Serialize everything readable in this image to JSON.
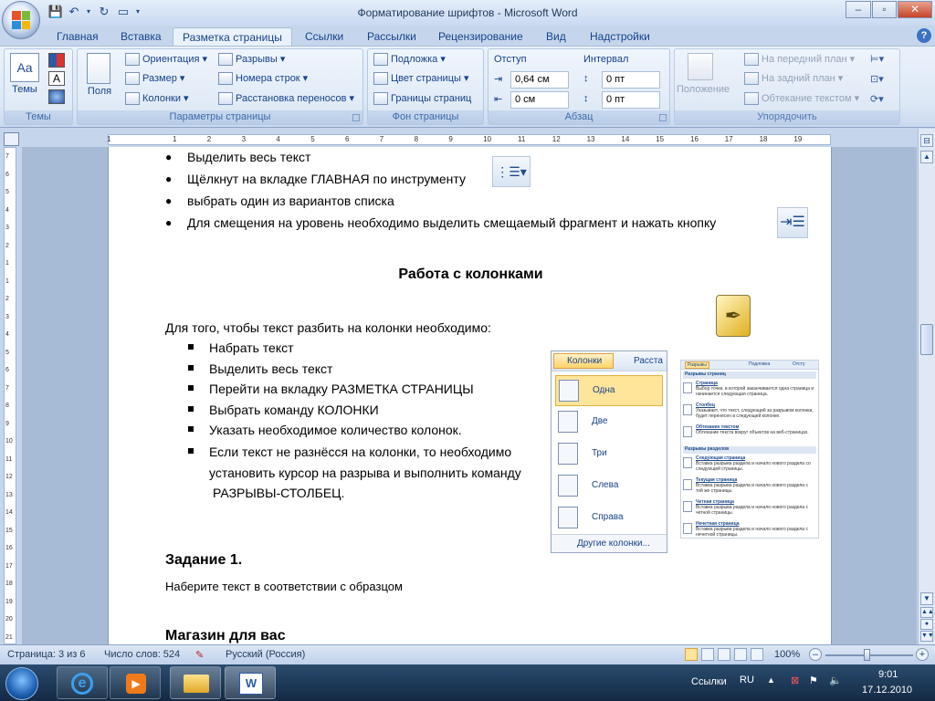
{
  "window": {
    "title": "Форматирование шрифтов - Microsoft Word"
  },
  "tabs": [
    "Главная",
    "Вставка",
    "Разметка страницы",
    "Ссылки",
    "Рассылки",
    "Рецензирование",
    "Вид",
    "Надстройки"
  ],
  "active_tab": "Разметка страницы",
  "ribbon": {
    "themes": {
      "label": "Темы",
      "group": "Темы"
    },
    "page_setup": {
      "fields": "Поля",
      "orientation": "Ориентация",
      "size": "Размер",
      "columns": "Колонки",
      "breaks": "Разрывы",
      "line_numbers": "Номера строк",
      "hyphenation": "Расстановка переносов",
      "group": "Параметры страницы"
    },
    "page_background": {
      "watermark": "Подложка",
      "page_color": "Цвет страницы",
      "page_borders": "Границы страниц",
      "group": "Фон страницы"
    },
    "paragraph": {
      "indent_header": "Отступ",
      "spacing_header": "Интервал",
      "indent_left": "0,64 см",
      "indent_right": "0 см",
      "spacing_before": "0 пт",
      "spacing_after": "0 пт",
      "group": "Абзац"
    },
    "arrange": {
      "position": "Положение",
      "bring_front": "На передний план",
      "send_back": "На задний план",
      "text_wrap": "Обтекание текстом",
      "group": "Упорядочить"
    }
  },
  "document": {
    "bullets_top": [
      "Выделить весь текст",
      "Щёлкнут на вкладке ГЛАВНАЯ по инструменту",
      "выбрать один из вариантов списка",
      "Для смещения на уровень необходимо выделить смещаемый фрагмент и нажать кнопку"
    ],
    "heading": "Работа с колонками",
    "intro": "Для того, чтобы текст разбить на колонки необходимо:",
    "steps": [
      "Набрать текст",
      "Выделить весь текст",
      "Перейти на вкладку РАЗМЕТКА СТРАНИЦЫ",
      "Выбрать команду КОЛОНКИ",
      "Указать необходимое количество колонок."
    ],
    "last_step_lines": [
      "Если текст не разнёсся на колонки, то необходимо",
      "установить курсор на разрыва и выполнить команду",
      "РАЗРЫВЫ-СТОЛБЕЦ."
    ],
    "task_heading": "Задание 1.",
    "task_text": "Наберите текст в соответствии с образцом",
    "bottom_heading": "Магазин для вас"
  },
  "columns_menu": {
    "button": "Колонки",
    "next_tab": "Расста",
    "items": [
      "Одна",
      "Две",
      "Три",
      "Слева",
      "Справа"
    ],
    "more": "Другие колонки..."
  },
  "breaks_picture": {
    "tabs": [
      "Разрывы",
      "Подложка",
      "Отсту"
    ],
    "section1": "Разрывы страниц",
    "section2": "Разрывы разделов",
    "entries": [
      {
        "title": "Страница",
        "desc": "Выбор точки, в которой заканчивается одна страница и начинается следующая страница."
      },
      {
        "title": "Столбец",
        "desc": "Указывает, что текст, следующий за разрывом колонки, будет перенесен в следующей колонке."
      },
      {
        "title": "Обтекание текстом",
        "desc": "Обтекание текста вокруг объектов на веб-страницах."
      },
      {
        "title": "Следующая страница",
        "desc": "Вставка разрыва раздела и начало нового раздела со следующей страницы."
      },
      {
        "title": "Текущая страница",
        "desc": "Вставка разрыва раздела и начало нового раздела с той же страницы."
      },
      {
        "title": "Четная страница",
        "desc": "Вставка разрыва раздела и начало нового раздела с четной страницы."
      },
      {
        "title": "Нечетная страница",
        "desc": "Вставка разрыва раздела и начало нового раздела с нечетной страницы."
      }
    ]
  },
  "status": {
    "page": "Страница: 3 из 6",
    "words": "Число слов: 524",
    "language": "Русский (Россия)",
    "zoom": "100%"
  },
  "taskbar": {
    "lang": "RU",
    "links": "Ссылки",
    "time": "9:01",
    "date": "17.12.2010"
  },
  "ruler": {
    "h_labels": [
      "1",
      "1",
      "2",
      "3",
      "4",
      "5",
      "6",
      "7",
      "8",
      "9",
      "10",
      "11",
      "12",
      "13",
      "14",
      "15",
      "16",
      "17",
      "18",
      "19"
    ],
    "v_labels": [
      "7",
      "6",
      "5",
      "4",
      "3",
      "2",
      "1",
      "1",
      "2",
      "3",
      "4",
      "5",
      "6",
      "7",
      "8",
      "9",
      "10",
      "11",
      "12",
      "13",
      "14",
      "15",
      "16",
      "17",
      "18",
      "19",
      "20",
      "21"
    ]
  },
  "colors": {
    "accent": "#15428b",
    "ribbon_bg": "#dde8f6",
    "doc_bg": "#a8bbd6"
  }
}
